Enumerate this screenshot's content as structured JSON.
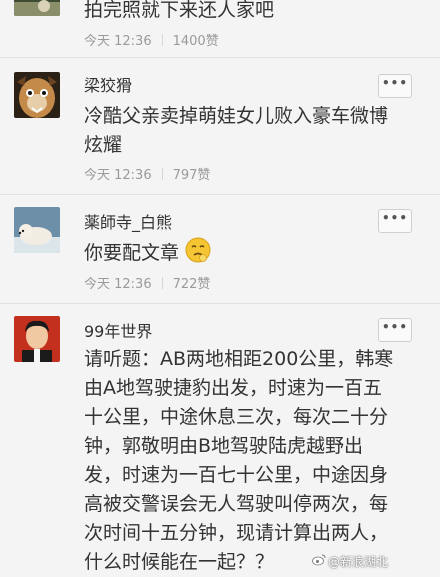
{
  "comments": [
    {
      "text": "拍完照就下来还人家吧",
      "time": "今天 12:36",
      "likes": "1400赞"
    },
    {
      "name": "梁狡猾",
      "text": "冷酷父亲卖掉萌娃女儿败入豪车微博炫耀",
      "time": "今天 12:36",
      "likes": "797赞",
      "more_label": "•••"
    },
    {
      "name": "薬師寺_白熊",
      "text": "你要配文章",
      "time": "今天 12:36",
      "likes": "722赞",
      "more_label": "•••"
    },
    {
      "name": "99年世界",
      "text": "请听题：AB两地相距200公里，韩寒由A地驾驶捷豹出发，时速为一百五十公里，中途休息三次，每次二十分钟，郭敬明由B地驾驶陆虎越野出发，时速为一百七十公里，中途因身高被交警误会无人驾驶叫停两次，每次时间十五分钟，现请计算出两人，什么时候能在一起？？",
      "more_label": "•••"
    }
  ],
  "watermark": "@新浪湖北",
  "icons": [
    "avatar",
    "more-icon",
    "thinking-emoji",
    "weibo-logo-icon"
  ]
}
